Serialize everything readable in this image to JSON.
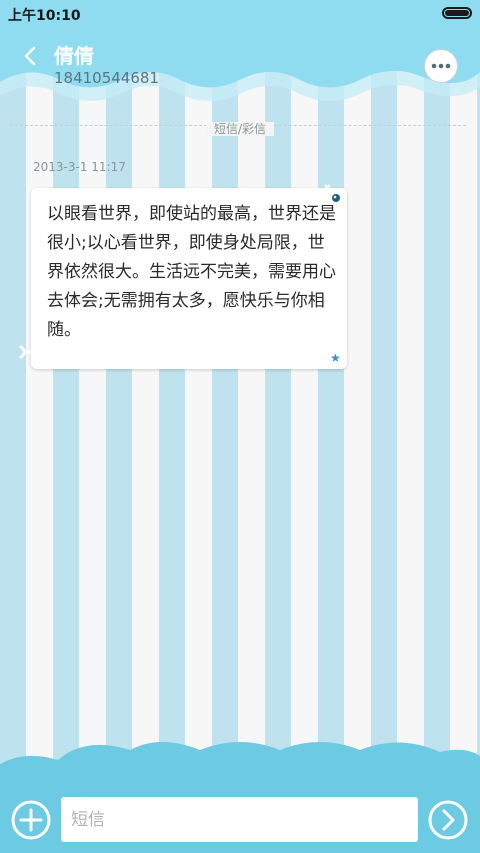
{
  "status_bar": {
    "time": "上午10:10"
  },
  "header": {
    "contact_name": "倩倩",
    "contact_number": "18410544681"
  },
  "conversation": {
    "channel_label": "短信/彩信",
    "messages": [
      {
        "timestamp": "2013-3-1 11:17",
        "text": "以眼看世界，即使站的最高，世界还是很小;以心看世界，即使身处局限，世界依然很大。生活远不完美，需要用心去体会;无需拥有太多，愿快乐与你相随。"
      }
    ]
  },
  "composer": {
    "placeholder": "短信"
  },
  "colors": {
    "header_blue": "#8fdcf0",
    "stripe_blue": "#bfe3ee",
    "footer_blue": "#6ccbe3",
    "star_blue": "#2f93d6"
  },
  "icons": [
    "back-chevron-icon",
    "more-dots-icon",
    "star-icon",
    "add-icon",
    "send-arrow-icon"
  ]
}
